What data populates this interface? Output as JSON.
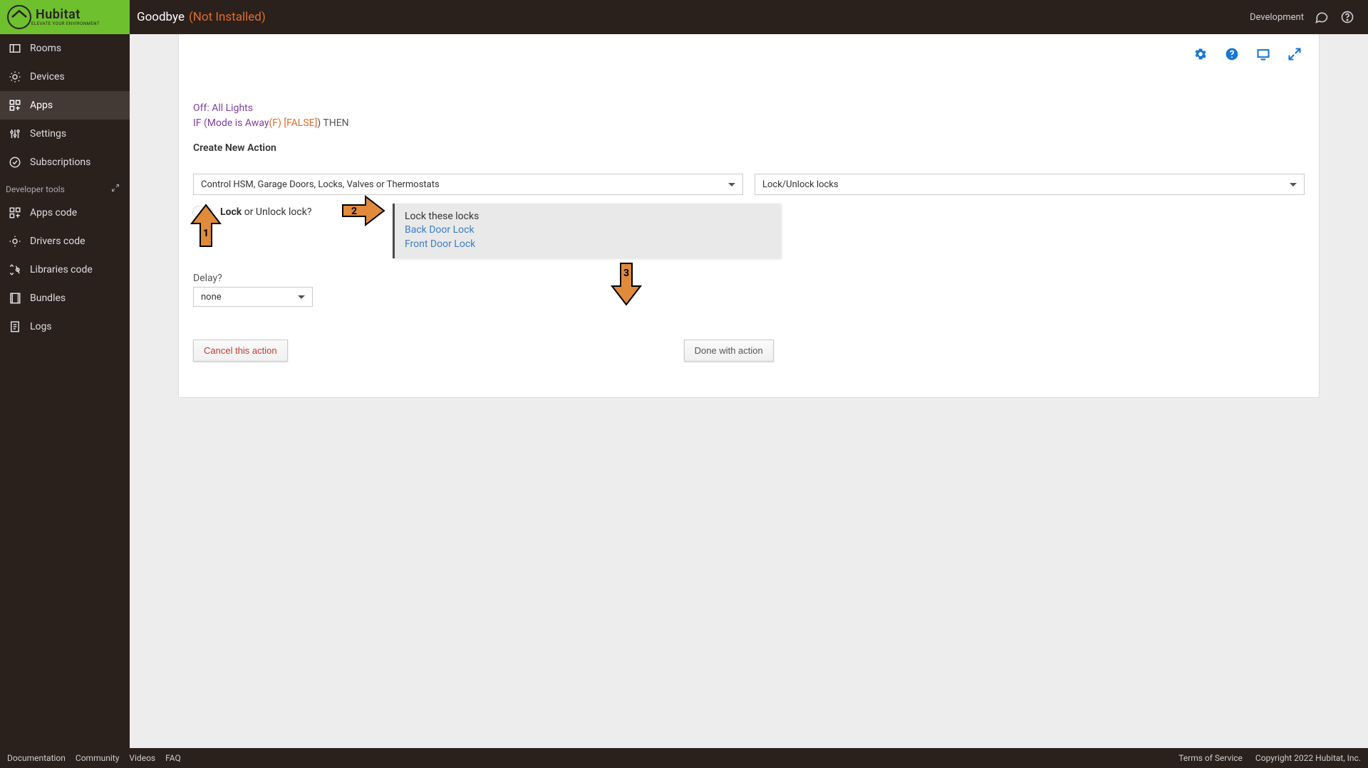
{
  "header": {
    "title": "Goodbye",
    "status": "(Not Installed)",
    "dev_label": "Development"
  },
  "logo": {
    "name": "Hubitat",
    "tagline": "ELEVATE YOUR ENVIRONMENT"
  },
  "sidebar": {
    "items": [
      {
        "label": "Rooms"
      },
      {
        "label": "Devices"
      },
      {
        "label": "Apps"
      },
      {
        "label": "Settings"
      },
      {
        "label": "Subscriptions"
      }
    ],
    "dev_section_label": "Developer tools",
    "dev_items": [
      {
        "label": "Apps code"
      },
      {
        "label": "Drivers code"
      },
      {
        "label": "Libraries code"
      },
      {
        "label": "Bundles"
      },
      {
        "label": "Logs"
      }
    ]
  },
  "rule": {
    "line1": "Off: All Lights",
    "if_prefix": "IF (Mode is Away",
    "if_false": "(F) [FALSE]",
    "if_then": ") THEN",
    "create_header": "Create New Action",
    "dropdown1": "Control HSM, Garage Doors, Locks, Valves or Thermostats",
    "dropdown2": "Lock/Unlock locks",
    "toggle_label_bold": "Lock",
    "toggle_label_rest": " or Unlock lock?",
    "locklist_header": "Lock these locks",
    "locklist": [
      "Back Door Lock",
      "Front Door Lock"
    ],
    "delay_label": "Delay?",
    "delay_value": "none",
    "cancel_btn": "Cancel this action",
    "done_btn": "Done with action"
  },
  "footer": {
    "links": [
      "Documentation",
      "Community",
      "Videos",
      "FAQ"
    ],
    "tos": "Terms of Service",
    "copyright": "Copyright 2022 Hubitat, Inc."
  }
}
